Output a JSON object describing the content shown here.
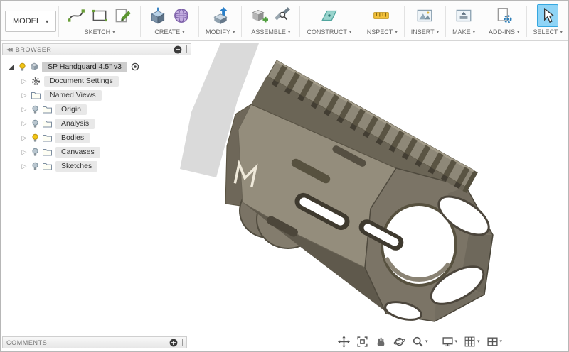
{
  "ui": {
    "caret": "▾",
    "collapse_left": "◀◀",
    "root_expand": "◢",
    "collapsed_arrow": "▷"
  },
  "workspace": {
    "label": "MODEL"
  },
  "toolbar_groups": [
    {
      "label": "SKETCH",
      "icons": [
        "spline-icon",
        "rectangle-sketch-icon",
        "create-sketch-icon"
      ]
    },
    {
      "label": "CREATE",
      "icons": [
        "extrude-box-icon",
        "form-sphere-icon"
      ]
    },
    {
      "label": "MODIFY",
      "icons": [
        "press-pull-icon"
      ]
    },
    {
      "label": "ASSEMBLE",
      "icons": [
        "new-component-icon",
        "joint-icon"
      ]
    },
    {
      "label": "CONSTRUCT",
      "icons": [
        "construction-plane-icon"
      ]
    },
    {
      "label": "INSPECT",
      "icons": [
        "measure-icon"
      ]
    },
    {
      "label": "INSERT",
      "icons": [
        "insert-canvas-icon"
      ]
    },
    {
      "label": "MAKE",
      "icons": [
        "make-print-icon"
      ]
    },
    {
      "label": "ADD-INS",
      "icons": [
        "scripts-addins-icon"
      ]
    },
    {
      "label": "SELECT",
      "icons": [
        "select-cursor-icon"
      ]
    }
  ],
  "browser": {
    "title": "BROWSER",
    "root_label": "SP Handguard 4.5\" v3",
    "items": [
      {
        "label": "Document Settings",
        "icon": "gear-icon",
        "bulb": "none"
      },
      {
        "label": "Named Views",
        "icon": "folder-icon",
        "bulb": "none"
      },
      {
        "label": "Origin",
        "icon": "folder-icon",
        "bulb": "off"
      },
      {
        "label": "Analysis",
        "icon": "folder-icon",
        "bulb": "off"
      },
      {
        "label": "Bodies",
        "icon": "folder-icon",
        "bulb": "on"
      },
      {
        "label": "Canvases",
        "icon": "folder-icon",
        "bulb": "off"
      },
      {
        "label": "Sketches",
        "icon": "folder-icon",
        "bulb": "off"
      }
    ]
  },
  "comments": {
    "title": "COMMENTS"
  },
  "navbar": {
    "icons": [
      "pan-icon",
      "zoom-fit-icon",
      "grab-hand-icon",
      "orbit-icon",
      "zoom-icon",
      "display-settings-icon",
      "grid-settings-icon",
      "viewports-icon"
    ]
  },
  "colors": {
    "select_highlight": "#8fd4f6",
    "bulb_on": "#f2c514",
    "bulb_off": "#b9c6cf",
    "model_body": "#8e8878",
    "model_dark": "#57513f",
    "ghost_canvas": "#dadada"
  }
}
